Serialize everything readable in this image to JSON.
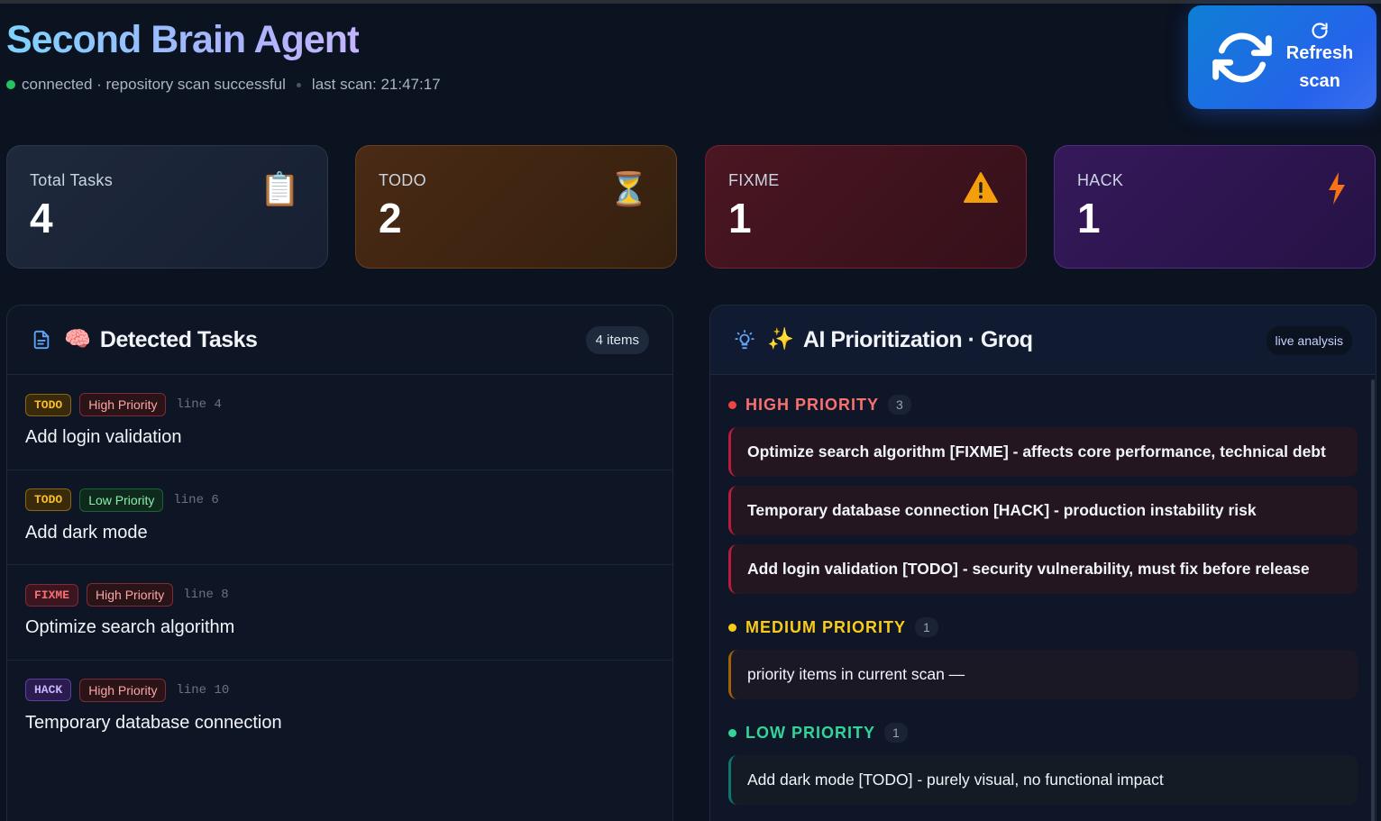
{
  "header": {
    "title": "Second Brain Agent",
    "status": "connected · repository scan successful",
    "last_scan": "last scan: 21:47:17",
    "refresh_label_1": "Refresh",
    "refresh_label_2": "scan"
  },
  "stats": [
    {
      "label": "Total Tasks",
      "value": "4",
      "icon": "clipboard-icon"
    },
    {
      "label": "TODO",
      "value": "2",
      "icon": "hourglass-icon"
    },
    {
      "label": "FIXME",
      "value": "1",
      "icon": "warning-icon"
    },
    {
      "label": "HACK",
      "value": "1",
      "icon": "lightning-icon"
    }
  ],
  "tasks_panel": {
    "title": "Detected Tasks",
    "count": "4 items",
    "items": [
      {
        "tag": "TODO",
        "priority": "High Priority",
        "line": "line 4",
        "title": "Add login validation"
      },
      {
        "tag": "TODO",
        "priority": "Low Priority",
        "line": "line 6",
        "title": "Add dark mode"
      },
      {
        "tag": "FIXME",
        "priority": "High Priority",
        "line": "line 8",
        "title": "Optimize search algorithm"
      },
      {
        "tag": "HACK",
        "priority": "High Priority",
        "line": "line 10",
        "title": "Temporary database connection"
      }
    ]
  },
  "ai_panel": {
    "title": "AI Prioritization · Groq",
    "badge": "live analysis",
    "groups": {
      "high": {
        "label": "HIGH PRIORITY",
        "count": "3",
        "items": [
          "Optimize search algorithm [FIXME] - affects core performance, technical debt",
          "Temporary database connection [HACK] - production instability risk",
          "Add login validation [TODO] - security vulnerability, must fix before release"
        ]
      },
      "medium": {
        "label": "MEDIUM PRIORITY",
        "count": "1",
        "items": [
          "priority items in current scan —"
        ]
      },
      "low": {
        "label": "LOW PRIORITY",
        "count": "1",
        "items": [
          "Add dark mode [TODO] - purely visual, no functional impact"
        ]
      }
    }
  },
  "colors": {
    "background": "#0b1220",
    "accent": "#2563eb",
    "high": "#ef4444",
    "medium": "#facc15",
    "low": "#34d399"
  }
}
